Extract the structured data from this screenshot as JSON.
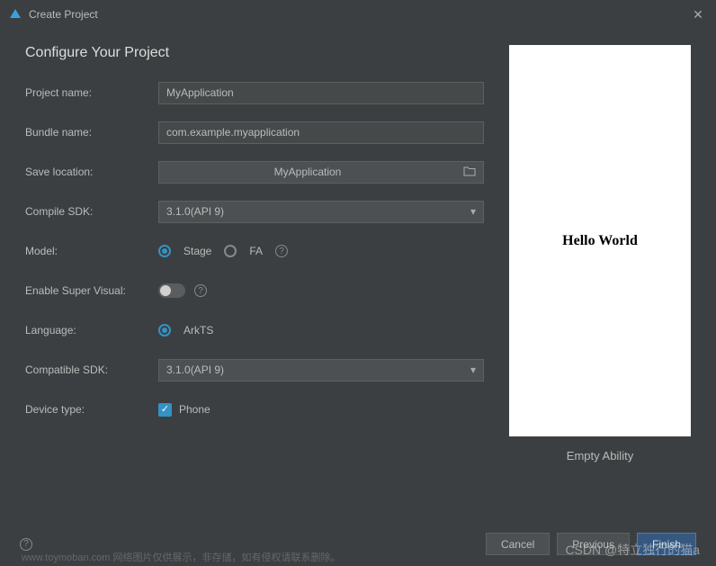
{
  "window": {
    "title": "Create Project"
  },
  "heading": "Configure Your Project",
  "fields": {
    "project_name": {
      "label": "Project name:",
      "value": "MyApplication"
    },
    "bundle_name": {
      "label": "Bundle name:",
      "value": "com.example.myapplication"
    },
    "save_location": {
      "label": "Save location:",
      "value": "MyApplication"
    },
    "compile_sdk": {
      "label": "Compile SDK:",
      "value": "3.1.0(API 9)"
    },
    "model": {
      "label": "Model:",
      "option_stage": "Stage",
      "option_fa": "FA",
      "selected": "Stage"
    },
    "super_visual": {
      "label": "Enable Super Visual:",
      "value": false
    },
    "language": {
      "label": "Language:",
      "option_arkts": "ArkTS",
      "selected": "ArkTS"
    },
    "compat_sdk": {
      "label": "Compatible SDK:",
      "value": "3.1.0(API 9)"
    },
    "device_type": {
      "label": "Device type:",
      "option_phone": "Phone",
      "phone_checked": true
    }
  },
  "preview": {
    "content": "Hello World",
    "caption": "Empty Ability"
  },
  "buttons": {
    "cancel": "Cancel",
    "previous": "Previous",
    "finish": "Finish"
  },
  "watermark": "CSDN @特立独行的猫a",
  "watermark_bottom": "www.toymoban.com 网络图片仅供展示，非存储，如有侵权请联系删除。"
}
